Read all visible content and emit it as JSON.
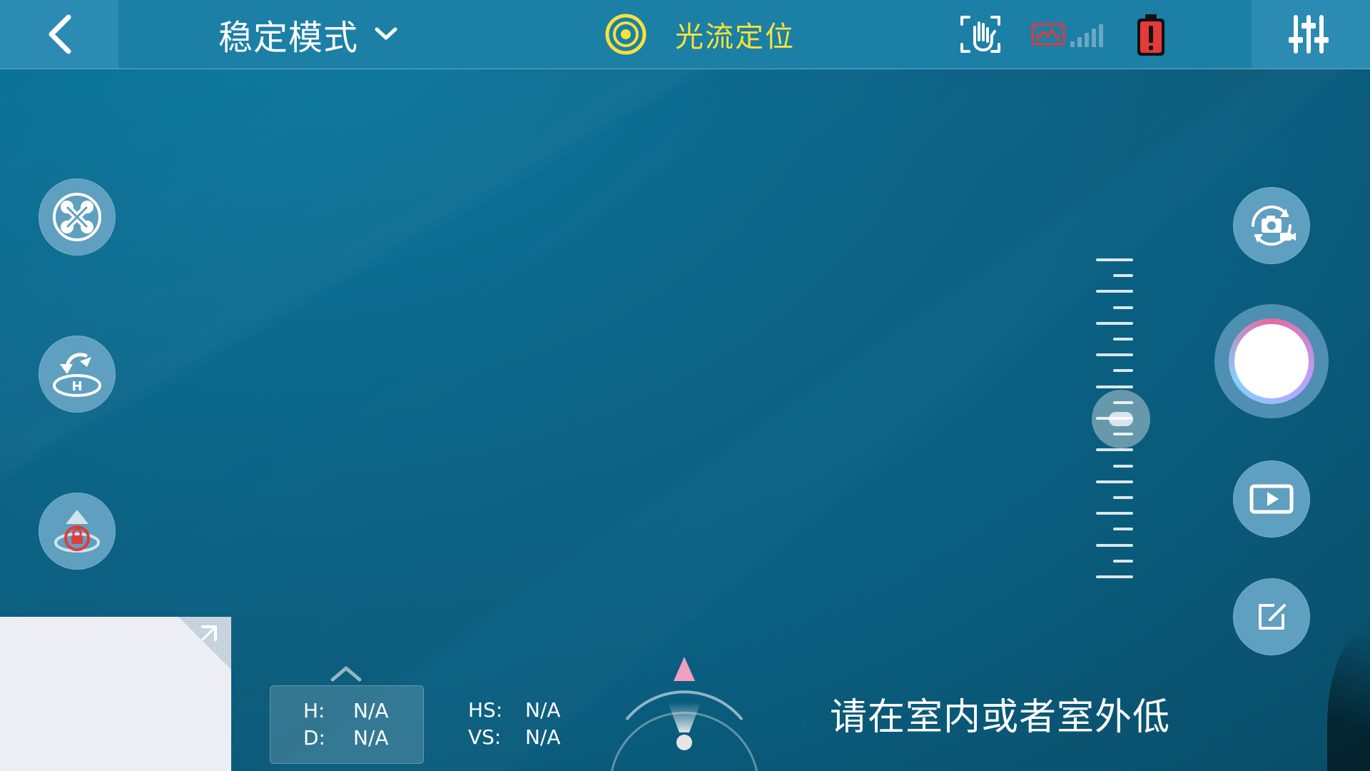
{
  "topbar": {
    "mode_label": "稳定模式",
    "positioning_label": "光流定位",
    "icons": {
      "back": "chevron-left-icon",
      "mode_dropdown": "chevron-down-icon",
      "positioning": "target-rings-icon",
      "gesture": "hand-gesture-icon",
      "video_signal": "video-signal-icon",
      "battery": "battery-warning-icon",
      "settings": "sliders-icon"
    }
  },
  "left_controls": {
    "icons": [
      "propeller-stop-icon",
      "return-home-icon",
      "altitude-lock-icon"
    ]
  },
  "right_controls": {
    "icons": [
      "camera-video-switch-icon",
      "shutter-button",
      "playback-icon",
      "edit-icon"
    ]
  },
  "slider": {
    "value": 0.5
  },
  "telemetry": {
    "h_label": "H:",
    "h_value": "N/A",
    "d_label": "D:",
    "d_value": "N/A",
    "hs_label": "HS:",
    "hs_value": "N/A",
    "vs_label": "VS:",
    "vs_value": "N/A"
  },
  "notice": {
    "text": "，请在室内或者室外低"
  },
  "colors": {
    "topbar": "#1c7fa6",
    "accent_yellow": "#f5e23a",
    "warning_red": "#e33a3a",
    "button": "#5f9fc0"
  }
}
